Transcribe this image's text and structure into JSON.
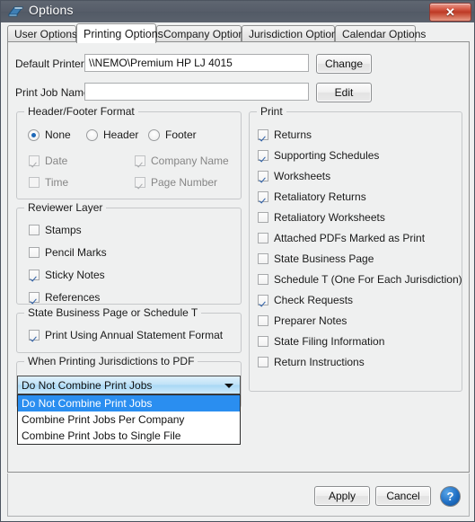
{
  "window": {
    "title": "Options",
    "icon": "options-book-icon",
    "close_label": "✕"
  },
  "tabs": [
    {
      "label": "User Options",
      "active": false
    },
    {
      "label": "Printing Options",
      "active": true
    },
    {
      "label": "Company Options",
      "active": false
    },
    {
      "label": "Jurisdiction Options",
      "active": false
    },
    {
      "label": "Calendar Options",
      "active": false
    }
  ],
  "printer_row": {
    "label": "Default Printer:",
    "value": "\\\\NEMO\\Premium HP LJ 4015",
    "button": "Change"
  },
  "jobname_row": {
    "label": "Print Job Name:",
    "value": "",
    "placeholder": "",
    "button": "Edit"
  },
  "header_footer_group": {
    "title": "Header/Footer Format",
    "radios": [
      {
        "label": "None",
        "selected": true
      },
      {
        "label": "Header",
        "selected": false
      },
      {
        "label": "Footer",
        "selected": false
      }
    ],
    "checkboxes": [
      {
        "label": "Date",
        "checked": true,
        "disabled": true
      },
      {
        "label": "Company Name",
        "checked": true,
        "disabled": true
      },
      {
        "label": "Time",
        "checked": false,
        "disabled": true
      },
      {
        "label": "Page Number",
        "checked": true,
        "disabled": true
      }
    ]
  },
  "reviewer_layer_group": {
    "title": "Reviewer Layer",
    "checkboxes": [
      {
        "label": "Stamps",
        "checked": false
      },
      {
        "label": "Pencil Marks",
        "checked": false
      },
      {
        "label": "Sticky Notes",
        "checked": true
      },
      {
        "label": "References",
        "checked": true
      }
    ]
  },
  "state_business_group": {
    "title": "State Business Page or Schedule T",
    "checkboxes": [
      {
        "label": "Print Using Annual Statement Format",
        "checked": true
      }
    ]
  },
  "pdf_group": {
    "title": "When Printing Jurisdictions to PDF",
    "selected": "Do Not Combine Print Jobs",
    "expanded": true,
    "options": [
      {
        "label": "Do Not Combine Print Jobs",
        "selected": true
      },
      {
        "label": "Combine Print Jobs Per Company",
        "selected": false
      },
      {
        "label": "Combine Print Jobs to Single File",
        "selected": false
      }
    ]
  },
  "print_group": {
    "title": "Print",
    "checkboxes": [
      {
        "label": "Returns",
        "checked": true
      },
      {
        "label": "Supporting Schedules",
        "checked": true
      },
      {
        "label": "Worksheets",
        "checked": true
      },
      {
        "label": "Retaliatory Returns",
        "checked": true
      },
      {
        "label": "Retaliatory Worksheets",
        "checked": false
      },
      {
        "label": "Attached PDFs Marked as Print",
        "checked": false
      },
      {
        "label": "State Business Page",
        "checked": false
      },
      {
        "label": "Schedule T (One For Each Jurisdiction)",
        "checked": false
      },
      {
        "label": "Check Requests",
        "checked": true
      },
      {
        "label": "Preparer Notes",
        "checked": false
      },
      {
        "label": "State Filing Information",
        "checked": false
      },
      {
        "label": "Return Instructions",
        "checked": false
      }
    ]
  },
  "footer": {
    "apply_label": "Apply",
    "cancel_label": "Cancel",
    "help_label": "?"
  },
  "colors": {
    "titlebar": "#565d69",
    "accent_blue": "#2a8ef0",
    "check_blue": "#2b5fa8",
    "close_red": "#bd3a25",
    "panel_bg": "#eff0f0"
  }
}
